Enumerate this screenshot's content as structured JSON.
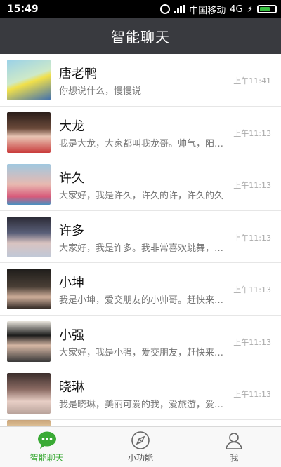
{
  "status_bar": {
    "time": "15:49",
    "carrier": "中国移动",
    "network": "4G"
  },
  "header": {
    "title": "智能聊天"
  },
  "chats": [
    {
      "name": "唐老鸭",
      "message": "你想说什么，慢慢说",
      "time": "上午11:41"
    },
    {
      "name": "大龙",
      "message": "我是大龙，大家都叫我龙哥。帅气，阳光，有型",
      "time": "上午11:13"
    },
    {
      "name": "许久",
      "message": "大家好，我是许久，许久的许，许久的久",
      "time": "上午11:13"
    },
    {
      "name": "许多",
      "message": "大家好，我是许多。我非常喜欢跳舞，唱歌",
      "time": "上午11:13"
    },
    {
      "name": "小坤",
      "message": "我是小坤，爱交朋友的小帅哥。赶快来找我聊天吧",
      "time": "上午11:13"
    },
    {
      "name": "小强",
      "message": "大家好，我是小强，爱交朋友，赶快来找我吧",
      "time": "上午11:13"
    },
    {
      "name": "晓琳",
      "message": "我是晓琳，美丽可爱的我，爱旅游，爱生活",
      "time": "上午11:13"
    }
  ],
  "tabs": [
    {
      "label": "智能聊天",
      "icon": "chat-bubble-icon",
      "active": true
    },
    {
      "label": "小功能",
      "icon": "compass-icon",
      "active": false
    },
    {
      "label": "我",
      "icon": "user-icon",
      "active": false
    }
  ],
  "colors": {
    "accent": "#3aaa35",
    "header_bg": "#393a3f"
  }
}
